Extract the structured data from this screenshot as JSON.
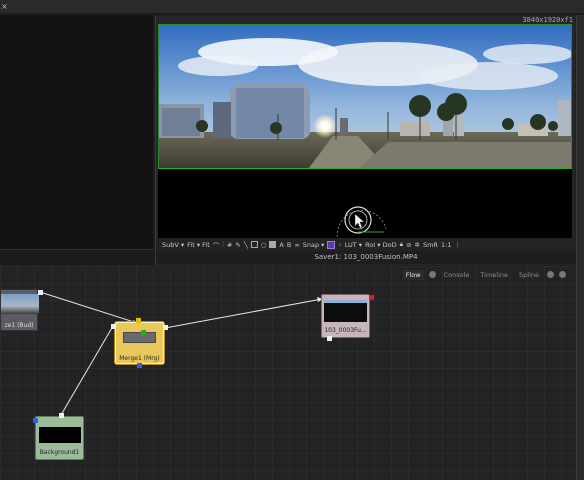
{
  "window": {
    "close_glyph": "×"
  },
  "viewer": {
    "resolution": "3840x1920xf1",
    "caption": "Saver1: 103_0003Fusion.MP4",
    "toolbar": {
      "subview": "SubV ▾",
      "fit": "Fit ▾ Fit",
      "snap": "Snap ▾",
      "lut": "LUT ▾",
      "roi": "RoI ▾ DoD",
      "smr": "SmR",
      "ratio": "1:1",
      "a_label": "A",
      "b_label": "B"
    }
  },
  "flow": {
    "tabs": [
      {
        "label": "Flow",
        "active": true
      },
      {
        "label": "Console",
        "active": false
      },
      {
        "label": "Timeline",
        "active": false
      },
      {
        "label": "Spline",
        "active": false
      }
    ],
    "nodes": {
      "blur": {
        "label": "ze1 (Bud)"
      },
      "merge": {
        "label": "Merge1 (Mrg)"
      },
      "saver": {
        "label": "103_0003Fu..."
      },
      "background": {
        "label": "Background1"
      }
    }
  },
  "colors": {
    "merge_node": "#e8c85c",
    "saver_node": "#c8b4bc",
    "background_node": "#9cbb98",
    "wire": "#e8e8e8",
    "canvas_border": "#28b028"
  }
}
